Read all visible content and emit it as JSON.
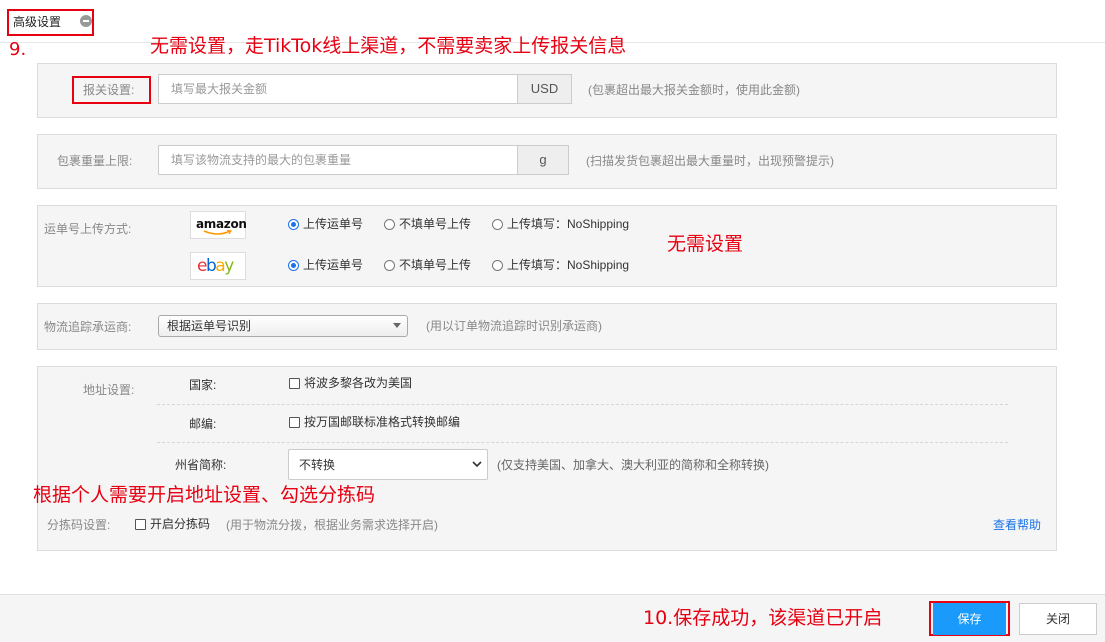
{
  "header": {
    "title": "高级设置",
    "collapse_icon": "minus-circle-icon"
  },
  "annotations": {
    "step9": "9.",
    "customs_note": "无需设置，走TikTok线上渠道，不需要卖家上传报关信息",
    "waybill_note": "无需设置",
    "address_note": "根据个人需要开启地址设置、勾选分拣码",
    "save_note": "10.保存成功，该渠道已开启"
  },
  "customs": {
    "label": "报关设置:",
    "placeholder": "填写最大报关金额",
    "unit": "USD",
    "hint": "(包裹超出最大报关金额时，使用此金额)"
  },
  "weight": {
    "label": "包裹重量上限:",
    "placeholder": "填写该物流支持的最大的包裹重量",
    "unit": "g",
    "hint": "(扫描发货包裹超出最大重量时，出现预警提示)"
  },
  "waybill": {
    "label": "运单号上传方式:",
    "platforms": [
      {
        "logo": "amazon",
        "options": [
          "上传运单号",
          "不填单号上传",
          "上传填写：NoShipping"
        ],
        "selected": 0
      },
      {
        "logo": "ebay",
        "options": [
          "上传运单号",
          "不填单号上传",
          "上传填写：NoShipping"
        ],
        "selected": 0
      }
    ]
  },
  "tracking": {
    "label": "物流追踪承运商:",
    "value": "根据运单号识别",
    "hint": "(用以订单物流追踪时识别承运商)"
  },
  "address": {
    "label": "地址设置:",
    "country_label": "国家:",
    "country_option": "将波多黎各改为美国",
    "postal_label": "邮编:",
    "postal_option": "按万国邮联标准格式转换邮编",
    "state_label": "州省简称:",
    "state_value": "不转换",
    "state_hint": "(仅支持美国、加拿大、澳大利亚的简称和全称转换)"
  },
  "sorting": {
    "label": "分拣码设置:",
    "option": "开启分拣码",
    "hint": "(用于物流分拨，根据业务需求选择开启)",
    "help": "查看帮助"
  },
  "footer": {
    "save": "保存",
    "close": "关闭"
  },
  "colors": {
    "accent": "#1a9bfc",
    "annotation": "#e60012",
    "link": "#1a73e8"
  }
}
